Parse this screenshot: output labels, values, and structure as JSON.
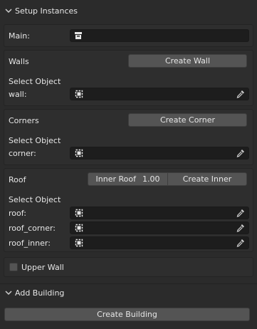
{
  "setup_panel": {
    "title": "Setup Instances",
    "main": {
      "label": "Main:"
    },
    "walls": {
      "title": "Walls",
      "button": "Create Wall",
      "select_label": "Select Object",
      "field_label": "wall:"
    },
    "corners": {
      "title": "Corners",
      "button": "Create Corner",
      "select_label": "Select Object",
      "field_label": "corner:"
    },
    "roof": {
      "title": "Roof",
      "inner_roof_label": "Inner Roof",
      "inner_roof_value": "1.00",
      "button": "Create Inner",
      "select_label": "Select Object",
      "fields": [
        "roof:",
        "roof_corner:",
        "roof_inner:"
      ]
    },
    "upper_wall": {
      "label": "Upper Wall",
      "checked": false
    }
  },
  "building_panel": {
    "title": "Add Building",
    "button": "Create Building"
  },
  "icons": {
    "panel_toggle": "chevron-down-icon",
    "collection": "collection-box-icon",
    "object": "object-icon",
    "eyedropper": "eyedropper-icon"
  }
}
